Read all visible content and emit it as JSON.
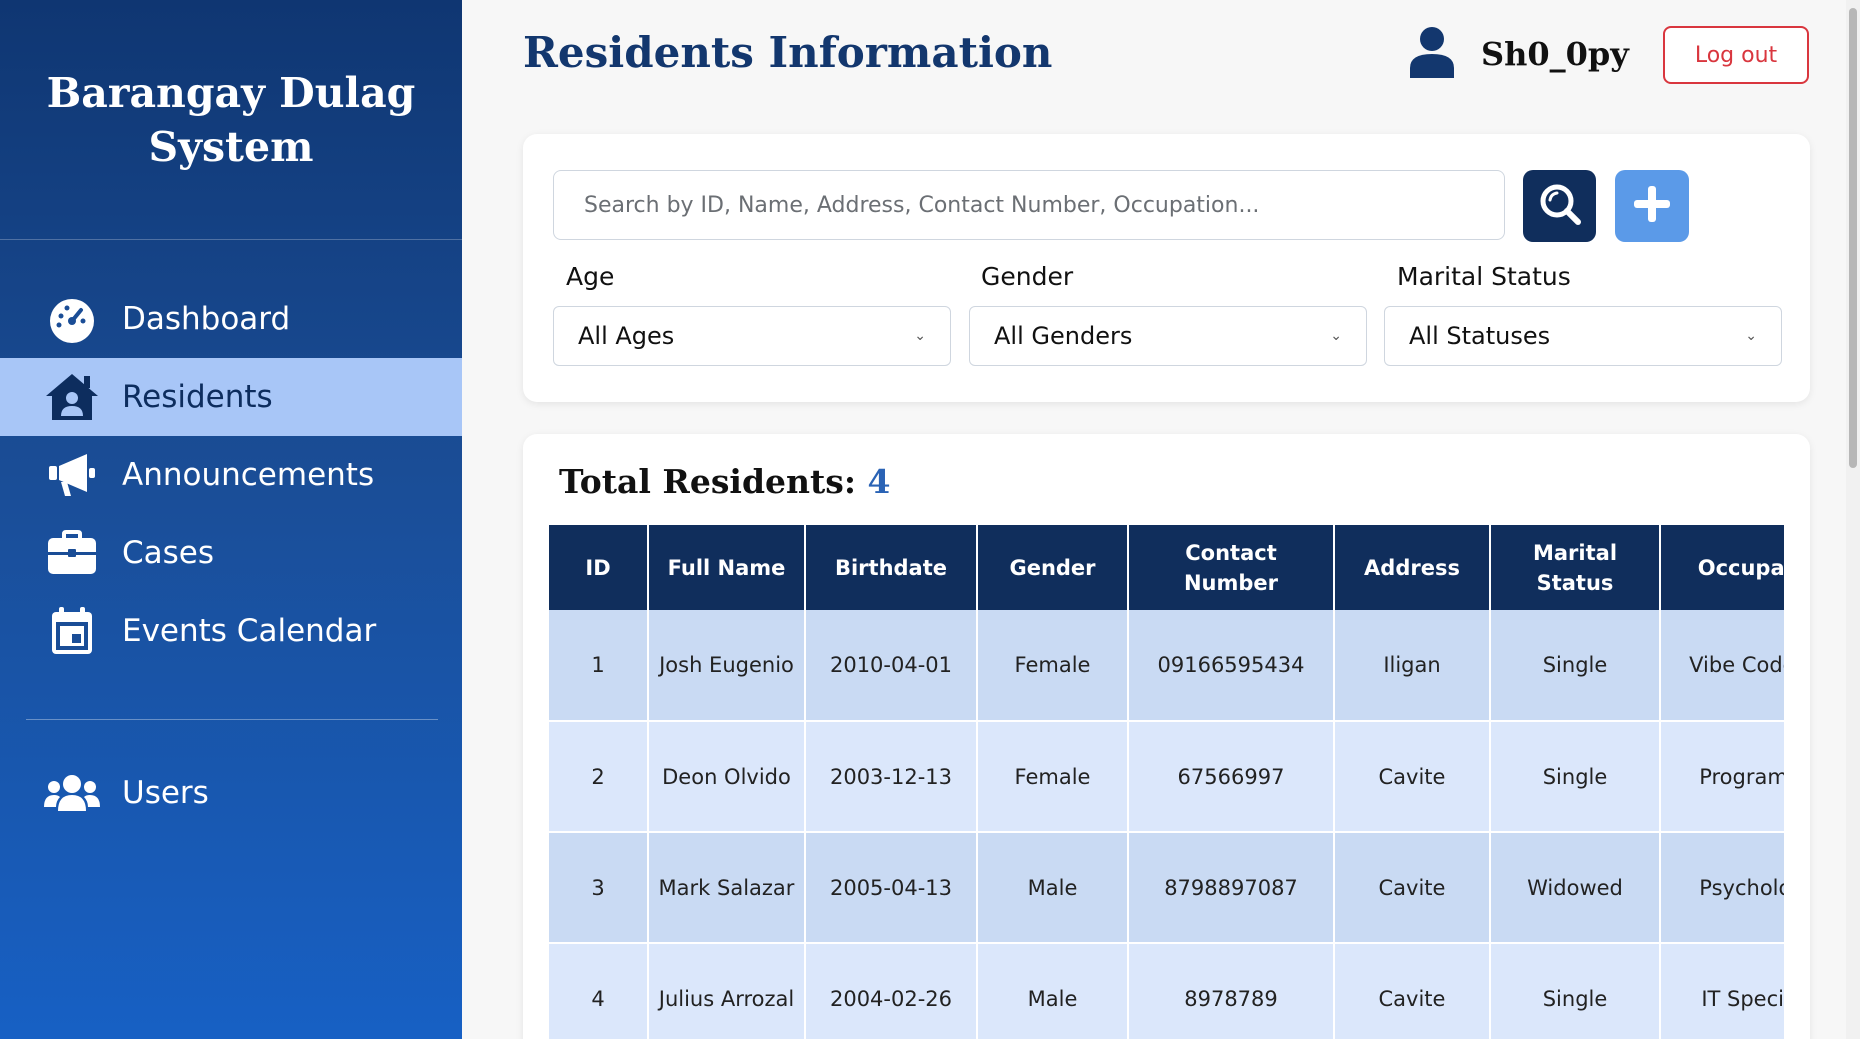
{
  "sidebar": {
    "brand": "Barangay Dulag System",
    "items": [
      {
        "label": "Dashboard",
        "icon": "gauge-icon",
        "active": false
      },
      {
        "label": "Residents",
        "icon": "house-user-icon",
        "active": true
      },
      {
        "label": "Announcements",
        "icon": "megaphone-icon",
        "active": false
      },
      {
        "label": "Cases",
        "icon": "briefcase-icon",
        "active": false
      },
      {
        "label": "Events Calendar",
        "icon": "calendar-icon",
        "active": false
      }
    ],
    "users_item": {
      "label": "Users",
      "icon": "users-icon"
    }
  },
  "header": {
    "title": "Residents Information",
    "username": "Sh0_0py",
    "logout_label": "Log out"
  },
  "filters": {
    "search_placeholder": "Search by ID, Name, Address, Contact Number, Occupation...",
    "age": {
      "label": "Age",
      "selected": "All Ages"
    },
    "gender": {
      "label": "Gender",
      "selected": "All Genders"
    },
    "marital": {
      "label": "Marital Status",
      "selected": "All Statuses"
    }
  },
  "summary": {
    "label": "Total Residents:",
    "count": "4"
  },
  "table": {
    "headers": [
      "ID",
      "Full Name",
      "Birthdate",
      "Gender",
      "Contact Number",
      "Address",
      "Marital Status",
      "Occupation"
    ],
    "rows": [
      {
        "id": "1",
        "name": "Josh Eugenio",
        "birthdate": "2010-04-01",
        "gender": "Female",
        "contact": "09166595434",
        "address": "Iligan",
        "marital": "Single",
        "occupation": "Vibe Coderlelz"
      },
      {
        "id": "2",
        "name": "Deon Olvido",
        "birthdate": "2003-12-13",
        "gender": "Female",
        "contact": "67566997",
        "address": "Cavite",
        "marital": "Single",
        "occupation": "Programmer"
      },
      {
        "id": "3",
        "name": "Mark Salazar",
        "birthdate": "2005-04-13",
        "gender": "Male",
        "contact": "8798897087",
        "address": "Cavite",
        "marital": "Widowed",
        "occupation": "Psychologist"
      },
      {
        "id": "4",
        "name": "Julius Arrozal",
        "birthdate": "2004-02-26",
        "gender": "Male",
        "contact": "8978789",
        "address": "Cavite",
        "marital": "Single",
        "occupation": "IT Specialist"
      }
    ]
  },
  "colors": {
    "primary": "#102e5c",
    "accent": "#5b9ae8",
    "active_nav": "#a8c6f7",
    "danger": "#d9363e"
  }
}
